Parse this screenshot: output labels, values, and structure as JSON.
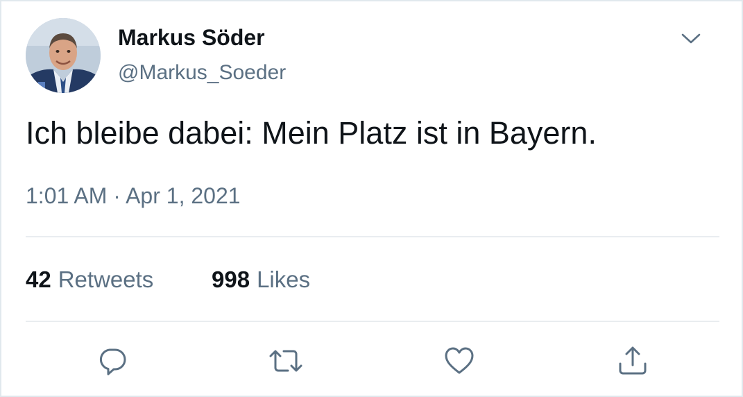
{
  "tweet": {
    "author": {
      "display_name": "Markus Söder",
      "handle": "@Markus_Soeder"
    },
    "text": "Ich bleibe dabei: Mein Platz ist in Bayern.",
    "timestamp": "1:01 AM · Apr 1, 2021",
    "stats": {
      "retweets": {
        "count": "42",
        "label": "Retweets"
      },
      "likes": {
        "count": "998",
        "label": "Likes"
      }
    },
    "actions": [
      "reply-icon",
      "retweet-icon",
      "like-icon",
      "share-icon"
    ],
    "menu_icon": "chevron-down-icon"
  },
  "colors": {
    "primary_text": "#0f1419",
    "secondary_text": "#5b7083",
    "divider": "#e9edf0",
    "border": "#e1e8ed",
    "icon": "#5b7083"
  }
}
